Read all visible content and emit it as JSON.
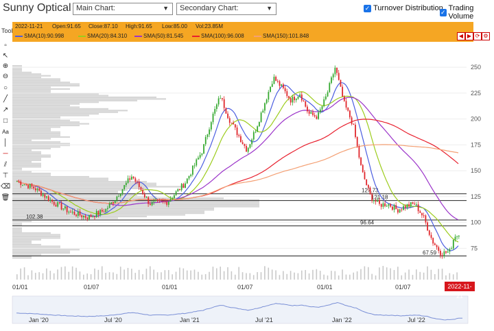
{
  "header": {
    "title": "Sunny Optical",
    "main_chart": "Main Chart:",
    "secondary_chart": "Secondary Chart:",
    "turnover_distribution": "Turnover Distribution",
    "trading_volume": "Trading Volume"
  },
  "toolbar": {
    "label": "Tool"
  },
  "info": {
    "date": "2022-11-21",
    "open": "Open:91.65",
    "close": "Close:87.10",
    "high": "High:91.65",
    "low": "Low:85.00",
    "vol": "Vol:23.85M",
    "sma": [
      {
        "label": "SMA(10):90.998",
        "color": "#4a5de0"
      },
      {
        "label": "SMA(20):84.310",
        "color": "#9ccc1c"
      },
      {
        "label": "SMA(50):81.545",
        "color": "#9b33c9"
      },
      {
        "label": "SMA(100):96.008",
        "color": "#e8202e"
      },
      {
        "label": "SMA(150):101.848",
        "color": "#f4a074"
      }
    ]
  },
  "chart_data": {
    "type": "candlestick",
    "y_ticks": [
      "250",
      "225",
      "200",
      "175",
      "150",
      "125",
      "100",
      "75"
    ],
    "x_ticks": [
      "01/01",
      "01/07",
      "01/01",
      "01/07",
      "01/01",
      "01/07"
    ],
    "navigator_ticks": [
      "Jan '20",
      "Jul '20",
      "Jan '21",
      "Jul '21",
      "Jan '22",
      "Jul '22"
    ],
    "ylim": [
      62,
      258
    ],
    "support_levels": [
      {
        "label": "127.73",
        "value": 127.73
      },
      {
        "label": "121.18",
        "value": 121.18
      },
      {
        "label": "102.38",
        "value": 102.38
      },
      {
        "label": "96.64",
        "value": 96.64
      },
      {
        "label": "67.59",
        "value": 67.59
      }
    ],
    "current_price": 87.1,
    "current_date": "2022-11-21",
    "trend_points": [
      [
        0,
        140
      ],
      [
        4,
        133
      ],
      [
        8,
        120
      ],
      [
        12,
        110
      ],
      [
        16,
        105
      ],
      [
        20,
        112
      ],
      [
        22,
        122
      ],
      [
        26,
        145
      ],
      [
        28,
        132
      ],
      [
        30,
        118
      ],
      [
        34,
        120
      ],
      [
        38,
        138
      ],
      [
        42,
        170
      ],
      [
        44,
        200
      ],
      [
        46,
        222
      ],
      [
        48,
        200
      ],
      [
        50,
        185
      ],
      [
        52,
        170
      ],
      [
        54,
        190
      ],
      [
        56,
        215
      ],
      [
        58,
        240
      ],
      [
        60,
        230
      ],
      [
        62,
        218
      ],
      [
        64,
        225
      ],
      [
        66,
        205
      ],
      [
        68,
        202
      ],
      [
        70,
        222
      ],
      [
        72,
        250
      ],
      [
        74,
        215
      ],
      [
        76,
        195
      ],
      [
        78,
        150
      ],
      [
        80,
        125
      ],
      [
        82,
        117
      ],
      [
        84,
        118
      ],
      [
        86,
        112
      ],
      [
        88,
        116
      ],
      [
        90,
        118
      ],
      [
        92,
        105
      ],
      [
        94,
        82
      ],
      [
        96,
        70
      ],
      [
        98,
        72
      ],
      [
        99,
        88
      ],
      [
        100,
        87
      ]
    ]
  }
}
